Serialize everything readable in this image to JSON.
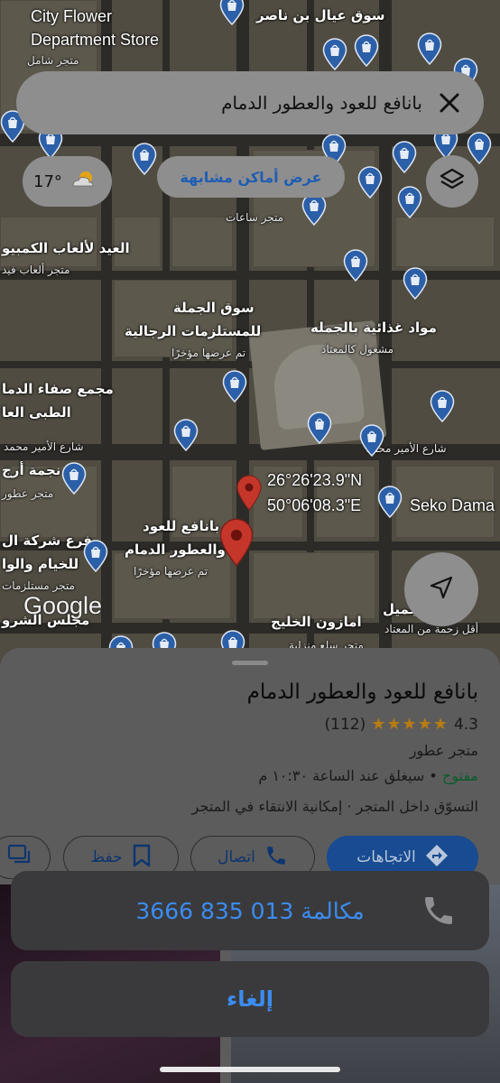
{
  "search": {
    "query": "بانافع للعود والعطور الدمام"
  },
  "weather": {
    "temperature": "17°",
    "icon": "partly-sunny-icon"
  },
  "map": {
    "similar_places_button": "عرض أماكن مشابهة",
    "coordinates_lat": "26°26'23.9\"N",
    "coordinates_lon": "50°06'08.3\"E",
    "google_logo": "Google",
    "labels": {
      "city_flower": "City Flower",
      "department_store": "Department Store",
      "store_shamil": "متجر شامل",
      "souq_ayal": "سوق عيال بن ناصر",
      "store_watches": "متجر ساعات",
      "al_eid_games": "العيد لألعاب الكمبيو",
      "games_store": "متجر ألعاب فيد",
      "souq_jumla": "سوق الجملة",
      "mens_supplies": "للمستلزمات الرجالية",
      "recently_viewed_1": "تم عرضها مؤخرًا",
      "food_supplies": "مواد غذائية بالجمله",
      "most_busy": "مشغول كالمعتاد",
      "medical_complex": "مجمع صفاء الدما",
      "medical_general": "الطبى العا",
      "prince_mohammed_st_1": "شارع الأمير محمد",
      "prince_mohammed_st_2": "شارع الأمير محمد",
      "najmat": "نجمة أرج",
      "perfume_store_left": "متجر عطور",
      "branch_company": "فرع شركة ال",
      "tents": "للخيام والوا",
      "store_supplies": "متجر مستلزمات",
      "store_name_1": "بانافع للعود",
      "store_name_2": "والعطور الدمام",
      "recently_viewed_2": "تم عرضها مؤخرًا",
      "seko": "Seko Dama",
      "khaleej_store": "امازون الخليج",
      "house_store": "متجر سلع منزلية",
      "jamil": "جميل",
      "less_busy": "أقل زحمة من المعتاد",
      "sharq": "مجلس الشرو"
    }
  },
  "place": {
    "name": "بانافع للعود والعطور الدمام",
    "rating": "4.3",
    "stars": "★★★★★",
    "reviews": "(112)",
    "category": "متجر عطور",
    "status_open": "مفتوح",
    "status_rest": " • سيغلق عند الساعة ١٠:٣٠ م",
    "features": "التسوّق داخل المتجر · إمكانية الانتقاء في المتجر",
    "actions": {
      "directions": "الاتجاهات",
      "call": "اتصال",
      "save": "حفظ"
    }
  },
  "action_sheet": {
    "call_label": "مكالمة 013 835 3666",
    "cancel_label": "إلغاء"
  },
  "colors": {
    "link_blue": "#3b8cf0",
    "sheet_bg": "#3a3a3c",
    "pin_blue": "#1a73e8",
    "pin_red": "#d93025"
  }
}
